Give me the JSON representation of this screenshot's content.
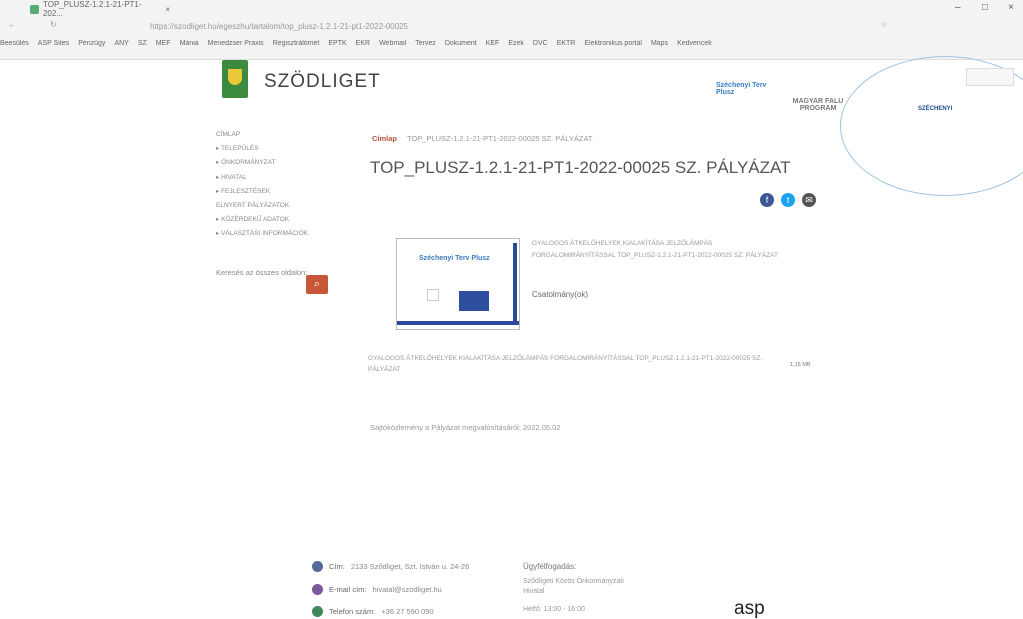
{
  "browser": {
    "tab_title": "TOP_PLUSZ-1.2.1-21-PT1-202...",
    "address": "https://szodliget.hu/egeszhu/tartalom/top_plusz-1.2.1-21-pt1-2022-00025",
    "bookmarks": [
      "Beesülés",
      "ASP Sites",
      "Pénzügy",
      "ÁNY",
      "SZ",
      "MEF",
      "Mánia",
      "Menedzser Praxis",
      "Regisztrálómet",
      "EPTK",
      "EKR",
      "Webmail",
      "Tervez",
      "Dokument",
      "KEF",
      "Ezek",
      "DVC",
      "EKTR",
      "Elektronikus portál",
      "Maps",
      "Kedvencek"
    ],
    "controls": {
      "min": "–",
      "max": "□",
      "close": "×"
    }
  },
  "header": {
    "site_name": "SZÖDLIGET",
    "partner_top": "Széchenyi Terv Plusz",
    "partner_mid": "MAGYAR FALU PROGRAM",
    "partner_right": "SZÉCHENYI"
  },
  "nav": {
    "items": [
      "CÍMLAP",
      "▸ TELEPÜLÉS",
      "▸ ÖNKORMÁNYZAT",
      "▸ HIVATAL",
      "▸ FEJLESZTÉSEK",
      "ELNYERT PÁLYÁZATOK",
      "▸ KÖZÉRDEKŰ ADATOK",
      "▸ VÁLASZTÁSI INFORMÁCIÓK"
    ],
    "search_label": "Keresés az összes oldalon:",
    "search_icon": "⌕"
  },
  "content": {
    "breadcrumb_home": "Címlap",
    "breadcrumb_current": "TOP_PLUSZ-1.2.1-21-PT1-2022-00025 SZ. PÁLYÁZAT",
    "title": "TOP_PLUSZ-1.2.1-21-PT1-2022-00025 SZ. PÁLYÁZAT",
    "share": {
      "facebook": "f",
      "twitter": "t",
      "email": "✉"
    },
    "poster_text": "Széchenyi Terv Plusz",
    "description": "GYALOGOS ÁTKELŐHELYEK KIALAKÍTÁSA JELZŐLÁMPÁS FORGALOMIRÁNYÍTÁSSAL TOP_PLUSZ-1.2.1-21-PT1-2022-00025 SZ. PÁLYÁZAT",
    "attachments_label": "Csatolmány(ok)",
    "file_name": "GYALOGOS ÁTKELŐHELYEK KIALAKÍTÁSA JELZŐLÁMPÁS FORGALOMIRÁNYÍTÁSSAL TOP_PLUSZ-1.2.1-21-PT1-2022-00025 SZ. PÁLYÁZAT",
    "file_size": "1,15 MB",
    "published": "Sajtóközlemény a Pályázat megvalósításáról: 2022.05.02"
  },
  "footer": {
    "address_label": "Cím:",
    "address_value": "2133 Sződliget, Szt. István u. 24-26",
    "email_label": "E-mail cím:",
    "email_value": "hivatal@szodliget.hu",
    "phone_label": "Telefon szám:",
    "phone_value": "+36 27 590 090",
    "service_title": "Ügyfélfogadás:",
    "service_office": "Sződligeti Közös Önkormányzati Hivatal",
    "service_hours": "Hétfő: 13:00 - 16:00",
    "watermark": "asp"
  },
  "colors": {
    "accent": "#b5533a",
    "search_button": "#c8573a",
    "facebook": "#3b5998",
    "twitter": "#1da1f2",
    "email": "#555555"
  }
}
